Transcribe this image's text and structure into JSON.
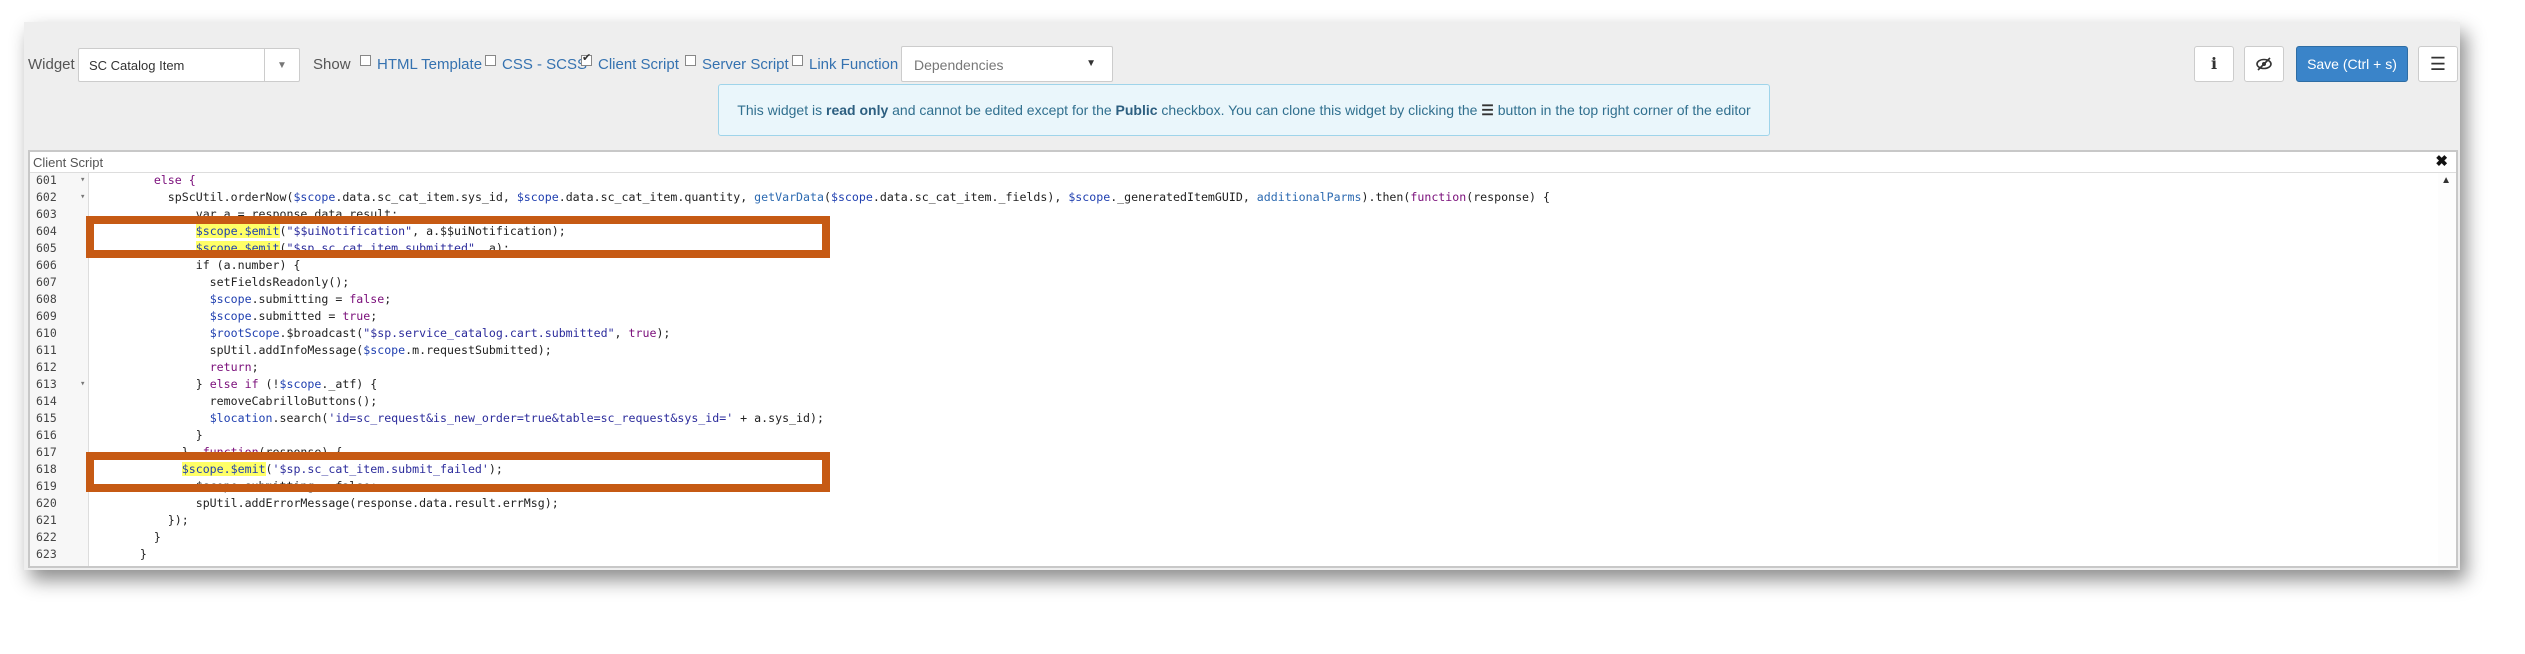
{
  "toolbar": {
    "widget_label": "Widget",
    "widget_value": "SC Catalog Item",
    "show_label": "Show",
    "checkboxes": [
      {
        "label": "HTML Template",
        "checked": false
      },
      {
        "label": "CSS - SCSS",
        "checked": false
      },
      {
        "label": "Client Script",
        "checked": true
      },
      {
        "label": "Server Script",
        "checked": false
      },
      {
        "label": "Link Function",
        "checked": false
      }
    ],
    "dependencies_placeholder": "Dependencies",
    "info_button": "i",
    "save_label": "Save (Ctrl + s)"
  },
  "banner": {
    "t1": "This widget is ",
    "b1": "read only",
    "t2": " and cannot be edited except for the ",
    "b2": "Public",
    "t3": " checkbox. You can clone this widget by clicking the ",
    "t4": " button in the top right corner of the editor"
  },
  "editor": {
    "title": "Client Script",
    "close": "✖",
    "lines": [
      {
        "n": "601",
        "fold": true
      },
      {
        "n": "602",
        "fold": true
      },
      {
        "n": "603",
        "fold": false
      },
      {
        "n": "604",
        "fold": false
      },
      {
        "n": "605",
        "fold": false
      },
      {
        "n": "606",
        "fold": false
      },
      {
        "n": "607",
        "fold": false
      },
      {
        "n": "608",
        "fold": false
      },
      {
        "n": "609",
        "fold": false
      },
      {
        "n": "610",
        "fold": false
      },
      {
        "n": "611",
        "fold": false
      },
      {
        "n": "612",
        "fold": false
      },
      {
        "n": "613",
        "fold": true
      },
      {
        "n": "614",
        "fold": false
      },
      {
        "n": "615",
        "fold": false
      },
      {
        "n": "616",
        "fold": false
      },
      {
        "n": "617",
        "fold": false
      },
      {
        "n": "618",
        "fold": false
      },
      {
        "n": "619",
        "fold": false
      },
      {
        "n": "620",
        "fold": false
      },
      {
        "n": "621",
        "fold": false
      },
      {
        "n": "622",
        "fold": false
      },
      {
        "n": "623",
        "fold": false
      }
    ],
    "code": {
      "l601": "        else {",
      "l602a": "          spScUtil.orderNow(",
      "l602b": "$scope",
      "l602c": ".data.sc_cat_item.sys_id, ",
      "l602d": "$scope",
      "l602e": ".data.sc_cat_item.quantity, ",
      "l602f": "getVarData",
      "l602g": "(",
      "l602h": "$scope",
      "l602i": ".data.sc_cat_item._fields), ",
      "l602j": "$scope",
      "l602k": "._generatedItemGUID, ",
      "l602l": "additionalParms",
      "l602m": ").then(",
      "l602n": "function",
      "l602o": "(response) {",
      "l603": "              var a = response.data.result;",
      "l604a": "              ",
      "l604b": "$scope.$emit",
      "l604c": "(",
      "l604d": "\"$$uiNotification\"",
      "l604e": ", a.$$uiNotification);",
      "l605a": "              ",
      "l605b": "$scope.$emit",
      "l605c": "(",
      "l605d": "\"$sp.sc_cat_item.submitted\"",
      "l605e": ", a);",
      "l606": "              if (a.number) {",
      "l607": "                setFieldsReadonly();",
      "l608a": "                ",
      "l608b": "$scope",
      "l608c": ".submitting = ",
      "l608d": "false",
      "l608e": ";",
      "l609a": "                ",
      "l609b": "$scope",
      "l609c": ".submitted = ",
      "l609d": "true",
      "l609e": ";",
      "l610a": "                ",
      "l610b": "$rootScope",
      "l610c": ".$broadcast(",
      "l610d": "\"$sp.service_catalog.cart.submitted\"",
      "l610e": ", ",
      "l610f": "true",
      "l610g": ");",
      "l611a": "                spUtil.addInfoMessage(",
      "l611b": "$scope",
      "l611c": ".m.requestSubmitted);",
      "l612a": "                ",
      "l612b": "return",
      "l612c": ";",
      "l613a": "              } ",
      "l613b": "else if",
      "l613c": " (!",
      "l613d": "$scope",
      "l613e": "._atf) {",
      "l614": "                removeCabrilloButtons();",
      "l615a": "                ",
      "l615b": "$location",
      "l615c": ".search(",
      "l615d": "'id=sc_request&is_new_order=true&table=sc_request&sys_id='",
      "l615e": " + a.sys_id);",
      "l616": "              }",
      "l617a": "            }, ",
      "l617b": "function",
      "l617c": "(response) {",
      "l618a": "            ",
      "l618b": "$scope.$emit",
      "l618c": "(",
      "l618d": "'$sp.sc_cat_item.submit_failed'",
      "l618e": ");",
      "l619": "              $scope.submitting = false;",
      "l620a": "              spUtil.addErrorMessage(response.data.result.errMsg);",
      "l621": "          });",
      "l622": "        }",
      "l623": "      }"
    }
  },
  "colors": {
    "accent": "#3a84c9",
    "highlight_box": "#c65a14",
    "emit_highlight": "#ffff66"
  }
}
